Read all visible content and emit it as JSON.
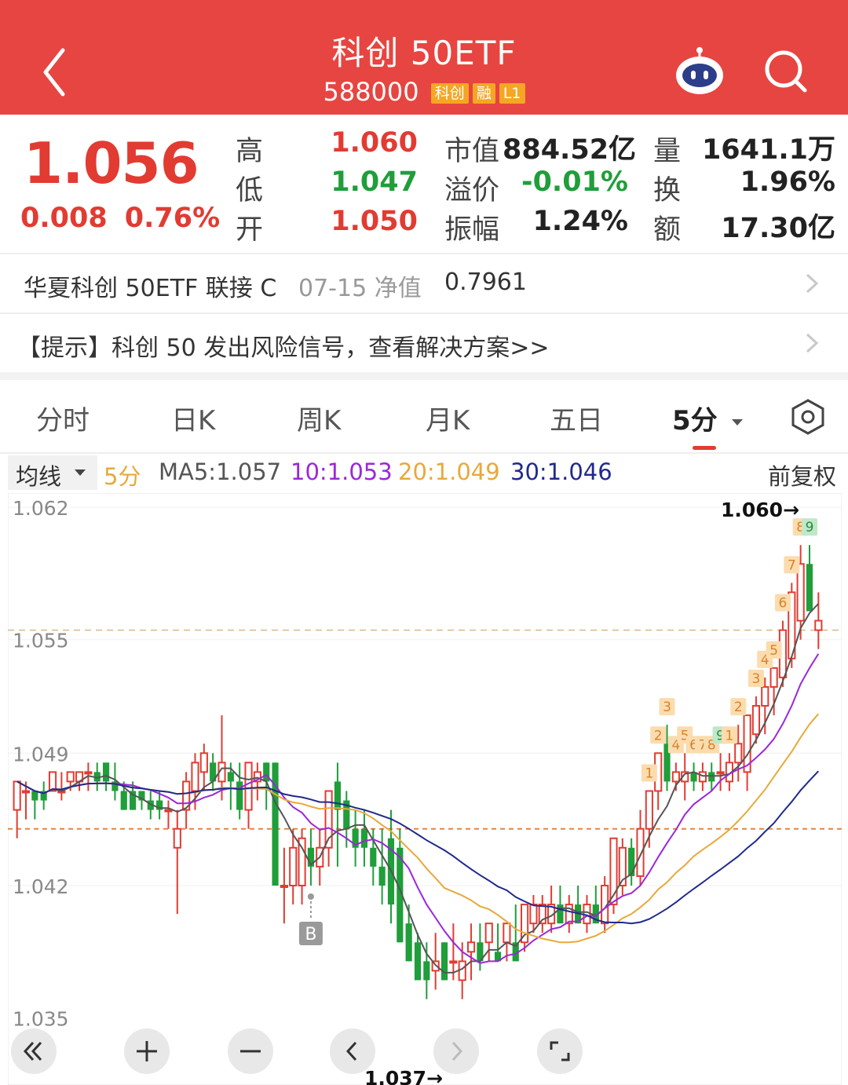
{
  "header": {
    "title": "科创 50ETF",
    "code": "588000",
    "tags": [
      {
        "label": "科创",
        "color": "#f5a623"
      },
      {
        "label": "融",
        "color": "#f5a623"
      },
      {
        "label": "L1",
        "color": "#f5a623"
      }
    ]
  },
  "quote": {
    "price": "1.056",
    "change": "0.008",
    "change_pct": "0.76%",
    "high_label": "高",
    "high": "1.060",
    "low_label": "低",
    "low": "1.047",
    "open_label": "开",
    "open": "1.050",
    "mcap_label": "市值",
    "mcap": "884.52亿",
    "premium_label": "溢价",
    "premium": "-0.01%",
    "amplitude_label": "振幅",
    "amplitude": "1.24%",
    "volume_label": "量",
    "volume": "1641.1万",
    "turnover_label": "换",
    "turnover": "1.96%",
    "amount_label": "额",
    "amount": "17.30亿"
  },
  "fund_row": {
    "name": "华夏科创 50ETF 联接 C",
    "date_label": "07-15 净值",
    "nav": "0.7961"
  },
  "tip_row": {
    "text": "【提示】科创 50 发出风险信号，查看解决方案>>"
  },
  "tabs": [
    "分时",
    "日K",
    "周K",
    "月K",
    "五日",
    "5分"
  ],
  "active_tab": "5分",
  "ma_bar": {
    "selector": "均线",
    "period": "5分",
    "ma5": "MA5:1.057",
    "ma10": "10:1.053",
    "ma20": "20:1.049",
    "ma30": "30:1.046",
    "adjust": "前复权"
  },
  "colors": {
    "header": "#e74541",
    "up": "#e23b32",
    "down": "#1f9e3a",
    "ma5": "#555555",
    "ma10": "#9b27d8",
    "ma20": "#e8a93a",
    "ma30": "#1f2a8c"
  },
  "chart_data": {
    "type": "candlestick",
    "y_ticks": [
      "1.062",
      "1.055",
      "1.049",
      "1.042",
      "1.035"
    ],
    "ylim": [
      1.035,
      1.062
    ],
    "high_marker": "1.060→",
    "low_marker": "1.037→",
    "signal_label": "B",
    "ref_lines": [
      1.0555,
      1.045
    ],
    "candles": [
      [
        1.046,
        1.0475,
        1.0445,
        1.0475
      ],
      [
        1.047,
        1.0475,
        1.0455,
        1.047
      ],
      [
        1.047,
        1.047,
        1.0455,
        1.0465
      ],
      [
        1.047,
        1.0475,
        1.046,
        1.0465
      ],
      [
        1.047,
        1.048,
        1.047,
        1.048
      ],
      [
        1.047,
        1.048,
        1.0465,
        1.047
      ],
      [
        1.0475,
        1.048,
        1.047,
        1.048
      ],
      [
        1.0475,
        1.048,
        1.047,
        1.048
      ],
      [
        1.048,
        1.0485,
        1.047,
        1.048
      ],
      [
        1.048,
        1.0485,
        1.047,
        1.0475
      ],
      [
        1.0485,
        1.0485,
        1.047,
        1.0475
      ],
      [
        1.0475,
        1.0485,
        1.0465,
        1.047
      ],
      [
        1.047,
        1.0475,
        1.046,
        1.046
      ],
      [
        1.047,
        1.0475,
        1.046,
        1.046
      ],
      [
        1.047,
        1.047,
        1.046,
        1.0465
      ],
      [
        1.0465,
        1.047,
        1.0455,
        1.046
      ],
      [
        1.0465,
        1.047,
        1.0455,
        1.046
      ],
      [
        1.046,
        1.0465,
        1.045,
        1.046
      ],
      [
        1.044,
        1.046,
        1.0405,
        1.045
      ],
      [
        1.046,
        1.048,
        1.045,
        1.0475
      ],
      [
        1.047,
        1.049,
        1.046,
        1.0485
      ],
      [
        1.048,
        1.0495,
        1.047,
        1.049
      ],
      [
        1.0485,
        1.049,
        1.047,
        1.0475
      ],
      [
        1.0475,
        1.051,
        1.0465,
        1.0485
      ],
      [
        1.048,
        1.0485,
        1.046,
        1.0475
      ],
      [
        1.0475,
        1.0485,
        1.0455,
        1.046
      ],
      [
        1.046,
        1.0485,
        1.045,
        1.0485
      ],
      [
        1.0475,
        1.0485,
        1.0465,
        1.048
      ],
      [
        1.0485,
        1.0485,
        1.046,
        1.0475
      ],
      [
        1.0485,
        1.0485,
        1.042,
        1.042
      ],
      [
        1.042,
        1.044,
        1.04,
        1.042
      ],
      [
        1.042,
        1.045,
        1.041,
        1.044
      ],
      [
        1.042,
        1.045,
        1.041,
        1.0445
      ],
      [
        1.044,
        1.045,
        1.042,
        1.043
      ],
      [
        1.043,
        1.045,
        1.042,
        1.044
      ],
      [
        1.044,
        1.047,
        1.043,
        1.047
      ],
      [
        1.0475,
        1.0485,
        1.043,
        1.046
      ],
      [
        1.0465,
        1.047,
        1.044,
        1.045
      ],
      [
        1.045,
        1.046,
        1.043,
        1.044
      ],
      [
        1.045,
        1.046,
        1.043,
        1.044
      ],
      [
        1.044,
        1.045,
        1.042,
        1.043
      ],
      [
        1.043,
        1.045,
        1.041,
        1.042
      ],
      [
        1.0445,
        1.046,
        1.04,
        1.041
      ],
      [
        1.044,
        1.045,
        1.039,
        1.039
      ],
      [
        1.04,
        1.041,
        1.038,
        1.038
      ],
      [
        1.039,
        1.0395,
        1.037,
        1.037
      ],
      [
        1.038,
        1.039,
        1.036,
        1.037
      ],
      [
        1.0375,
        1.0395,
        1.0365,
        1.038
      ],
      [
        1.039,
        1.039,
        1.037,
        1.037
      ],
      [
        1.038,
        1.04,
        1.037,
        1.038
      ],
      [
        1.037,
        1.039,
        1.036,
        1.038
      ],
      [
        1.0385,
        1.04,
        1.037,
        1.039
      ],
      [
        1.039,
        1.04,
        1.0375,
        1.038
      ],
      [
        1.039,
        1.04,
        1.038,
        1.04
      ],
      [
        1.0385,
        1.04,
        1.038,
        1.038
      ],
      [
        1.039,
        1.04,
        1.038,
        1.04
      ],
      [
        1.039,
        1.041,
        1.038,
        1.038
      ],
      [
        1.039,
        1.041,
        1.0385,
        1.041
      ],
      [
        1.04,
        1.0415,
        1.0395,
        1.041
      ],
      [
        1.04,
        1.0415,
        1.0395,
        1.041
      ],
      [
        1.04,
        1.042,
        1.0395,
        1.041
      ],
      [
        1.041,
        1.042,
        1.04,
        1.04
      ],
      [
        1.04,
        1.0415,
        1.0395,
        1.041
      ],
      [
        1.041,
        1.042,
        1.04,
        1.04
      ],
      [
        1.04,
        1.0415,
        1.0395,
        1.041
      ],
      [
        1.041,
        1.042,
        1.04,
        1.04
      ],
      [
        1.04,
        1.0425,
        1.0395,
        1.042
      ],
      [
        1.041,
        1.0445,
        1.0405,
        1.0445
      ],
      [
        1.042,
        1.0445,
        1.0415,
        1.044
      ],
      [
        1.044,
        1.0445,
        1.042,
        1.0425
      ],
      [
        1.0425,
        1.046,
        1.042,
        1.045
      ],
      [
        1.045,
        1.047,
        1.044,
        1.047
      ],
      [
        1.047,
        1.049,
        1.046,
        1.049
      ],
      [
        1.0495,
        1.0505,
        1.047,
        1.0475
      ],
      [
        1.0475,
        1.0485,
        1.047,
        1.048
      ],
      [
        1.0475,
        1.049,
        1.0465,
        1.048
      ],
      [
        1.048,
        1.0485,
        1.047,
        1.0475
      ],
      [
        1.0475,
        1.0485,
        1.047,
        1.048
      ],
      [
        1.048,
        1.0485,
        1.047,
        1.0475
      ],
      [
        1.048,
        1.049,
        1.047,
        1.048
      ],
      [
        1.0475,
        1.049,
        1.047,
        1.0485
      ],
      [
        1.0485,
        1.0505,
        1.0475,
        1.0495
      ],
      [
        1.048,
        1.051,
        1.047,
        1.051
      ],
      [
        1.05,
        1.052,
        1.0495,
        1.0515
      ],
      [
        1.0515,
        1.053,
        1.05,
        1.0525
      ],
      [
        1.0525,
        1.0535,
        1.051,
        1.0535
      ],
      [
        1.053,
        1.056,
        1.0525,
        1.0555
      ],
      [
        1.054,
        1.058,
        1.0535,
        1.0575
      ],
      [
        1.056,
        1.06,
        1.055,
        1.059
      ],
      [
        1.059,
        1.06,
        1.0565,
        1.0565
      ],
      [
        1.0555,
        1.0575,
        1.0545,
        1.056
      ]
    ],
    "td_labels": [
      {
        "i": 71,
        "text": "1",
        "color": "orange"
      },
      {
        "i": 72,
        "text": "2",
        "color": "orange"
      },
      {
        "i": 73,
        "text": "3",
        "color": "orange"
      },
      {
        "i": 74,
        "text": "4",
        "color": "orange"
      },
      {
        "i": 75,
        "text": "5",
        "color": "orange"
      },
      {
        "i": 76,
        "text": "6",
        "color": "orange"
      },
      {
        "i": 77,
        "text": "7",
        "color": "orange"
      },
      {
        "i": 78,
        "text": "8",
        "color": "orange"
      },
      {
        "i": 79,
        "text": "9",
        "color": "green"
      },
      {
        "i": 80,
        "text": "1",
        "color": "orange"
      },
      {
        "i": 81,
        "text": "2",
        "color": "orange"
      },
      {
        "i": 83,
        "text": "3",
        "color": "orange"
      },
      {
        "i": 84,
        "text": "4",
        "color": "orange"
      },
      {
        "i": 85,
        "text": "5",
        "color": "orange"
      },
      {
        "i": 86,
        "text": "6",
        "color": "orange"
      },
      {
        "i": 87,
        "text": "7",
        "color": "orange"
      },
      {
        "i": 88,
        "text": "8",
        "color": "orange"
      },
      {
        "i": 89,
        "text": "9",
        "color": "green"
      }
    ],
    "signal_index": 33
  }
}
